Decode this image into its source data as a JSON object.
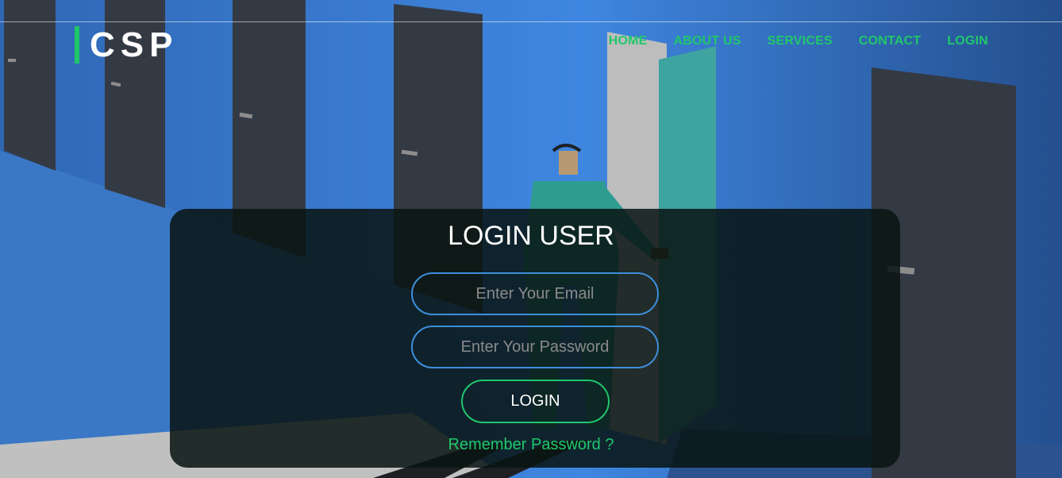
{
  "brand": {
    "logo_text": "CSP",
    "accent_color": "#1fc66a"
  },
  "nav": {
    "items": [
      {
        "label": "HOME"
      },
      {
        "label": "ABOUT US"
      },
      {
        "label": "SERVICES"
      },
      {
        "label": "CONTACT"
      },
      {
        "label": "LOGIN"
      }
    ]
  },
  "login_form": {
    "title": "LOGIN USER",
    "email_placeholder": "Enter Your Email",
    "password_placeholder": "Enter Your Password",
    "submit_label": "LOGIN",
    "remember_link": "Remember Password ?"
  },
  "colors": {
    "input_border": "#3d8fdb",
    "panel_bg": "#081412",
    "text": "#ffffff"
  }
}
